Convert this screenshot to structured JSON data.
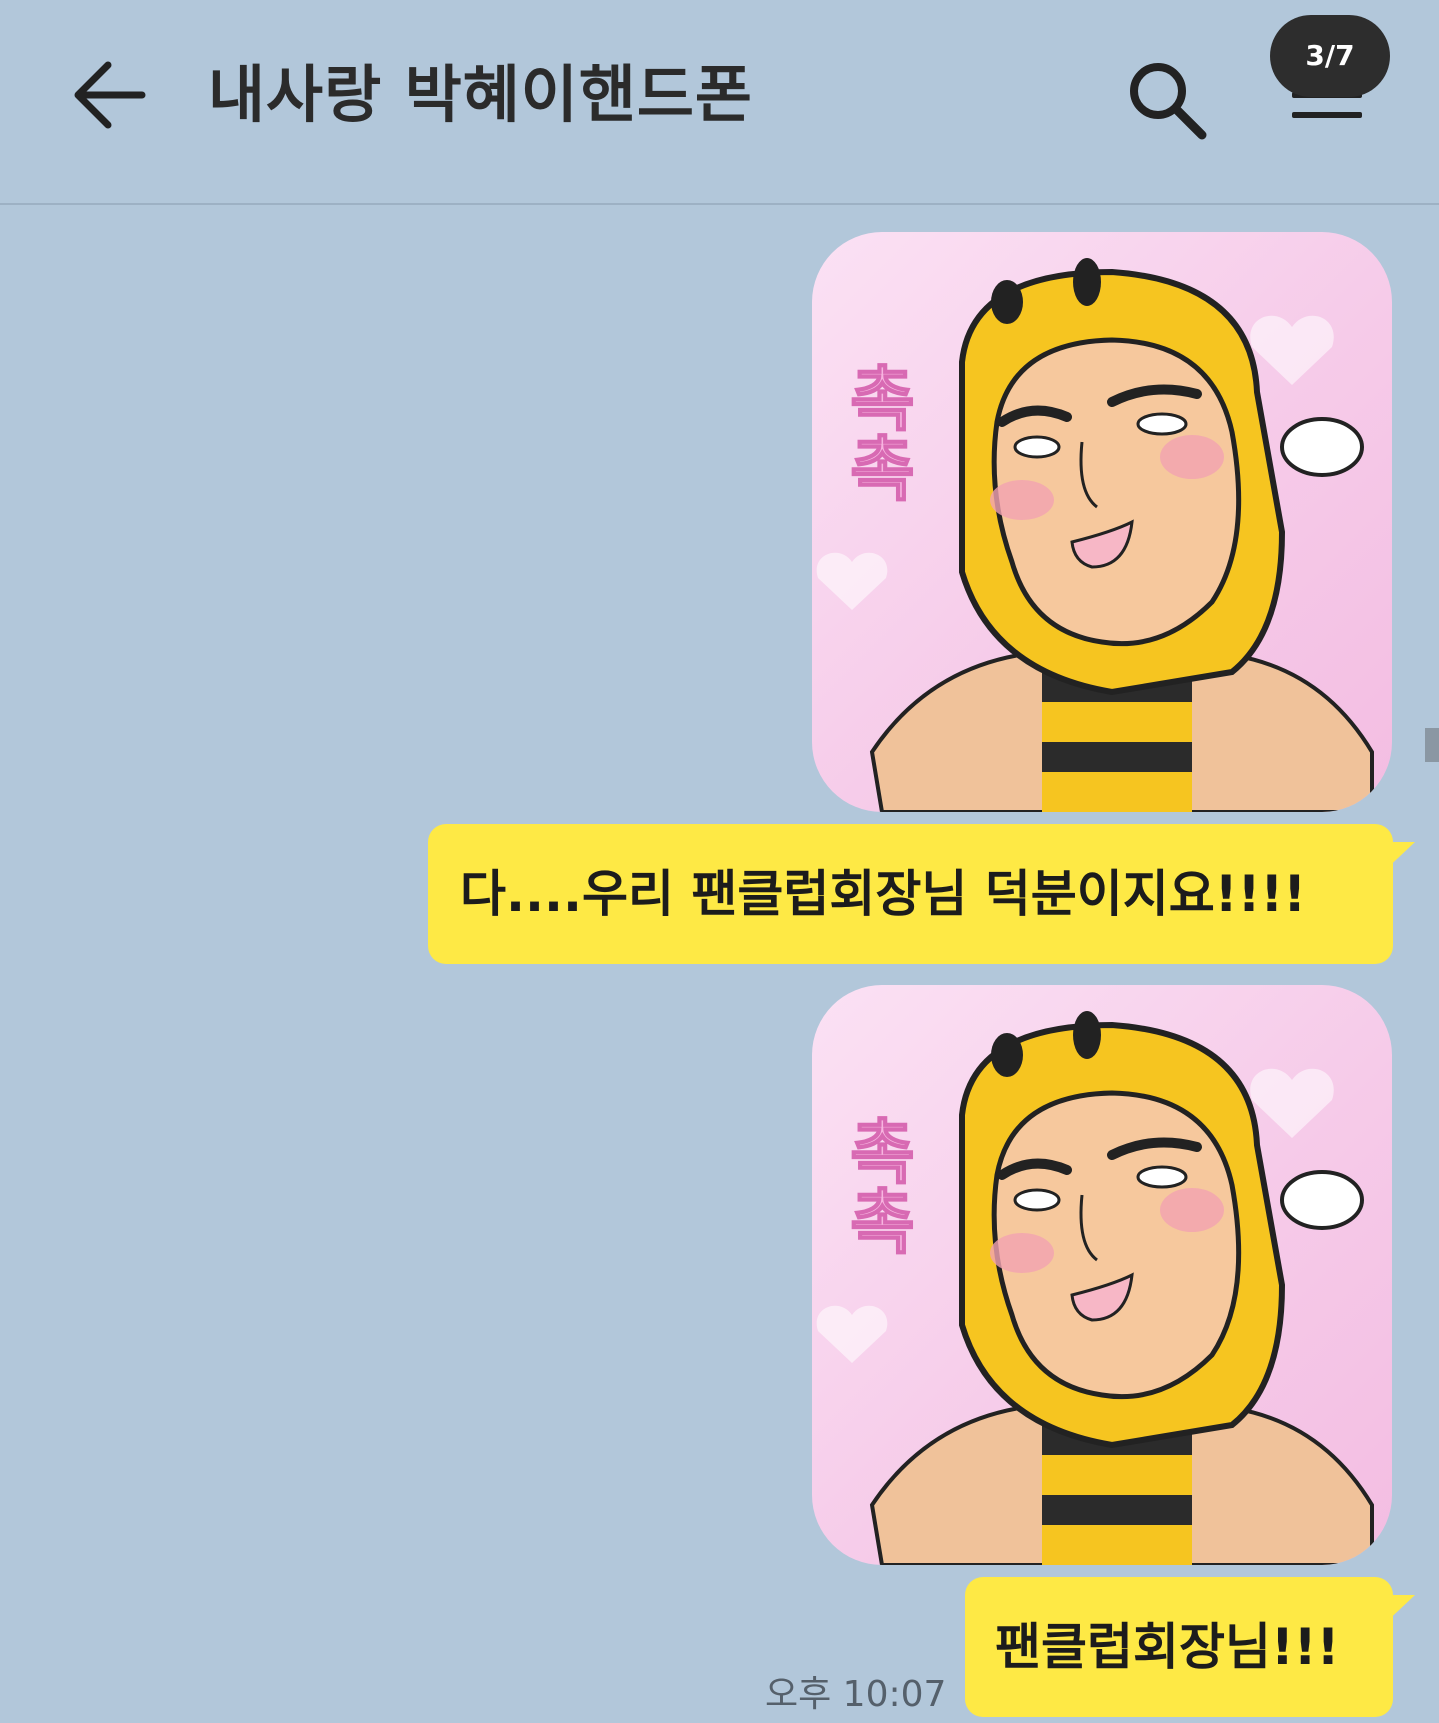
{
  "header": {
    "title": "내사랑 박혜이핸드폰",
    "back_icon": "arrow-left-icon",
    "search_icon": "search-icon",
    "menu_icon": "hamburger-menu-icon"
  },
  "page_indicator": "3/7",
  "messages": [
    {
      "type": "sticker",
      "caption": "촉촉"
    },
    {
      "type": "text",
      "text": "다....우리 팬클럽회장님 덕분이지요!!!!"
    },
    {
      "type": "sticker",
      "caption": "촉촉"
    },
    {
      "type": "text",
      "text": "팬클럽회장님!!!"
    }
  ],
  "last_message_time": "오후 10:07",
  "colors": {
    "background": "#b2c7da",
    "bubble": "#fee945",
    "sticker_bg": "#f6cbe9"
  }
}
